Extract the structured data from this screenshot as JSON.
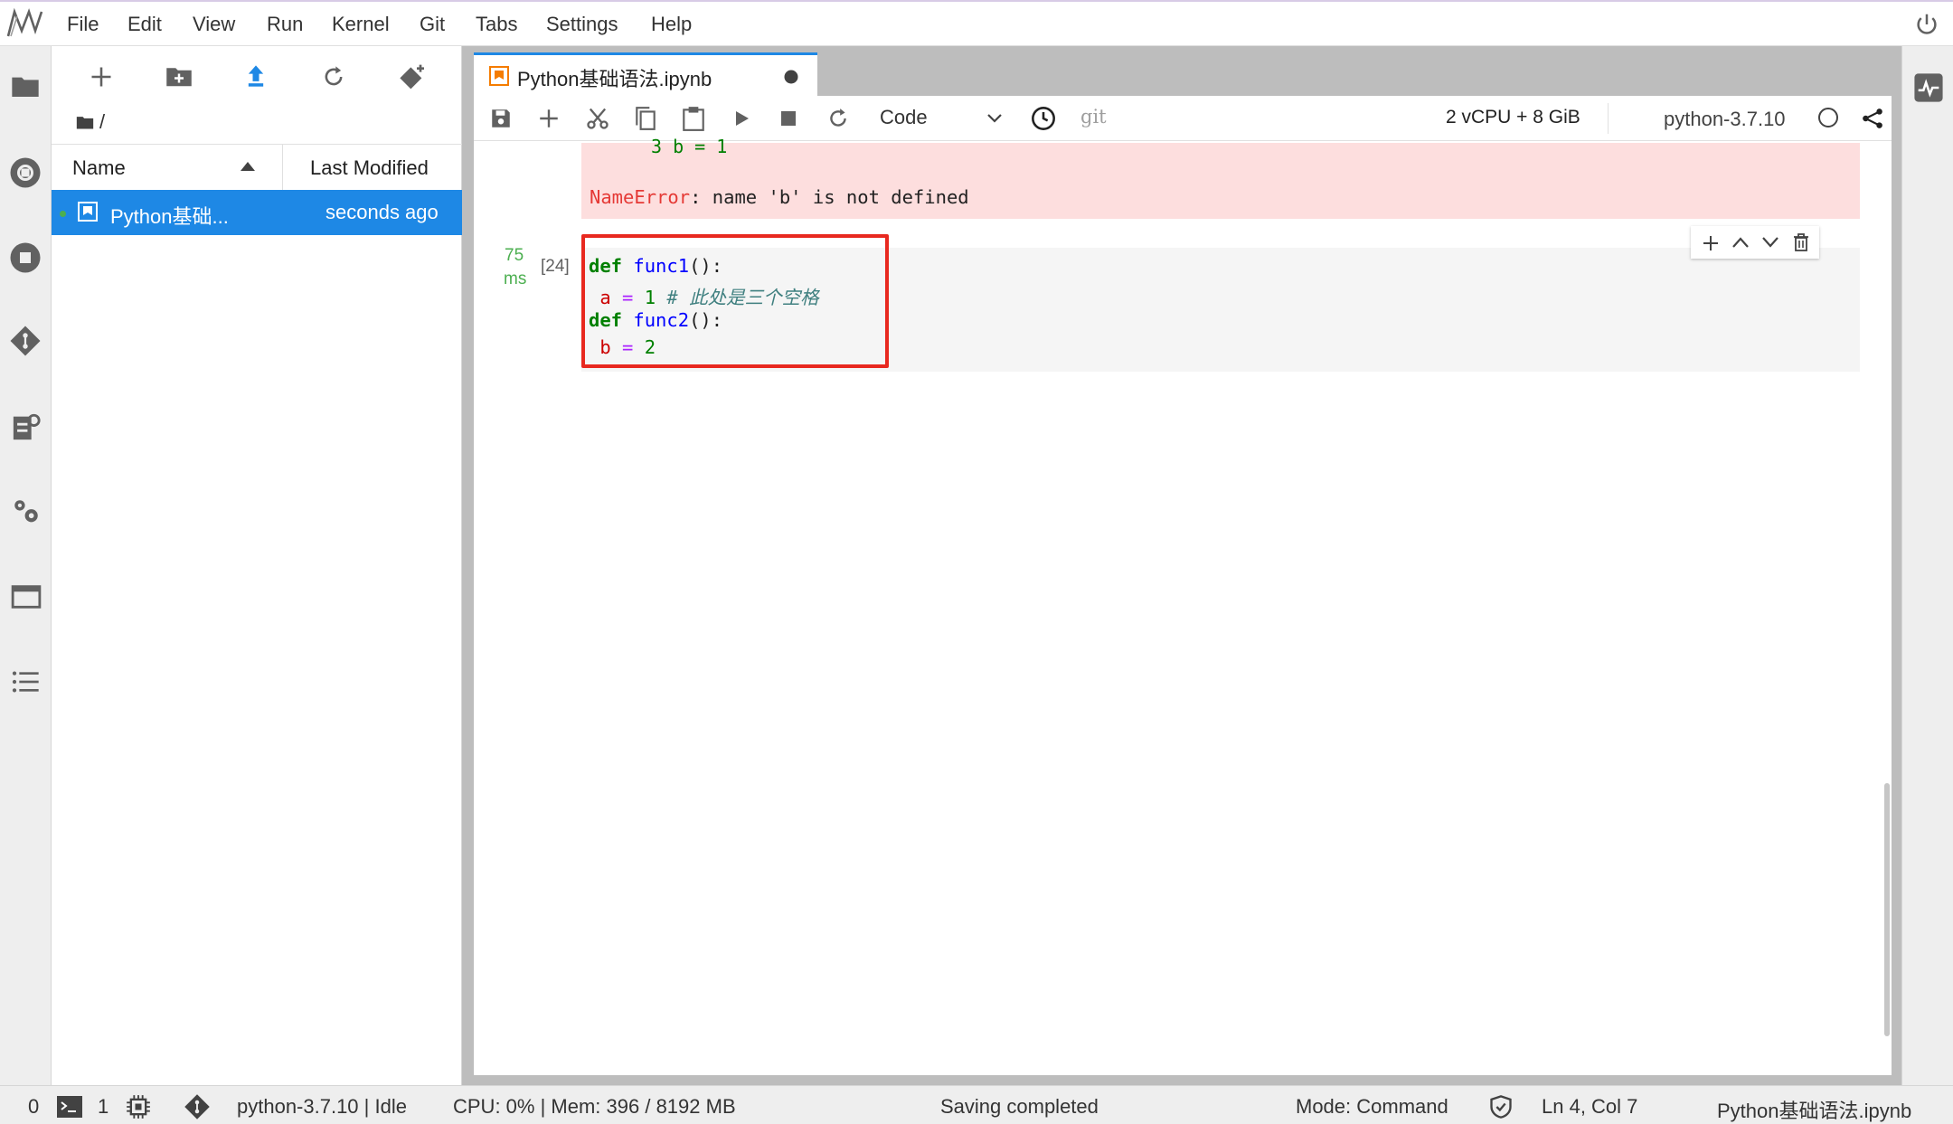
{
  "menu": {
    "logo": "jupyter-logo",
    "items": [
      "File",
      "Edit",
      "View",
      "Run",
      "Kernel",
      "Git",
      "Tabs",
      "Settings",
      "Help"
    ]
  },
  "file_browser": {
    "path": "/",
    "columns": {
      "name": "Name",
      "modified": "Last Modified"
    },
    "rows": [
      {
        "name": "Python基础...",
        "modified": "seconds ago"
      }
    ]
  },
  "notebook": {
    "tab_title": "Python基础语法.ipynb",
    "cell_type": "Code",
    "git_label": "git",
    "resources": "2 vCPU + 8 GiB",
    "kernel": "python-3.7.10",
    "error_prev": "3 b = 1",
    "error_name": "NameError",
    "error_msg": ": name 'b' is not defined",
    "exec_time": "75",
    "exec_unit": "ms",
    "exec_count": "[24]",
    "code": {
      "l1_kw": "def",
      "l1_fn": "func1",
      "l1_rest": "():",
      "l2_var": "a",
      "l2_op": "=",
      "l2_num": "1",
      "l2_com": "# 此处是三个空格",
      "l3_kw": "def",
      "l3_fn": "func2",
      "l3_rest": "():",
      "l4_var": "b",
      "l4_op": "=",
      "l4_num": "2"
    }
  },
  "status": {
    "terminals": "0",
    "kernels": "1",
    "kernel_state": "python-3.7.10 | Idle",
    "cpu_mem": "CPU: 0% | Mem: 396 / 8192 MB",
    "saving": "Saving completed",
    "mode": "Mode: Command",
    "position": "Ln 4, Col 7",
    "filename": "Python基础语法.ipynb"
  },
  "colors": {
    "accent": "#1e88e5",
    "error_bg": "#fddede",
    "highlight": "#e8281f",
    "notebook_icon": "#f57c00"
  }
}
